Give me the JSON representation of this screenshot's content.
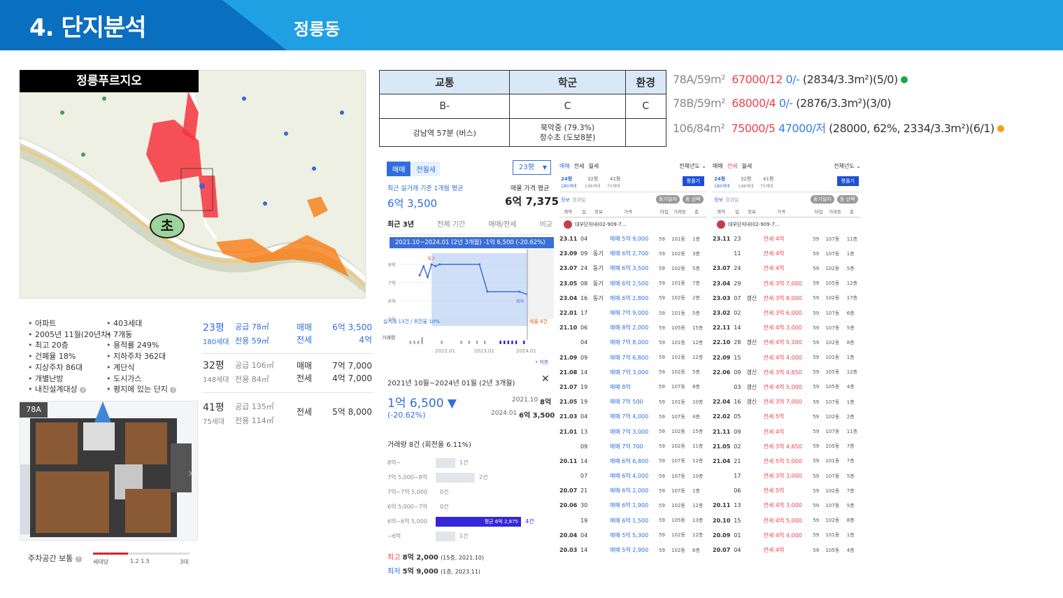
{
  "header": {
    "title": "4. 단지분석",
    "subtitle": "정릉동"
  },
  "map": {
    "label": "정릉푸르지오",
    "school_marker": "초"
  },
  "facts": {
    "left": [
      "아파트",
      "2005년 11월(20년차)",
      "최고 20층",
      "건폐율 18%",
      "지상주차 86대",
      "개별난방",
      "내진설계대상"
    ],
    "right": [
      "403세대",
      "7개동",
      "용적률 249%",
      "지하주차 362대",
      "계단식",
      "도시가스",
      "평지에 있는 단지"
    ]
  },
  "floorplan": {
    "tag": "78A"
  },
  "parking": {
    "label": "주차공간 보통",
    "per": "세대당",
    "ticks": "1.2 1.5",
    "max": "3대"
  },
  "types": [
    {
      "pyeong": "23평",
      "units": "180세대",
      "supply": "공급 78㎡",
      "exclusive": "전용 59㎡",
      "deal1": "매매",
      "price1": "6억 3,500",
      "deal2": "전세",
      "price2": "4억"
    },
    {
      "pyeong": "32평",
      "units": "148세대",
      "supply": "공급 106㎡",
      "exclusive": "전용 84㎡",
      "deal1": "매매",
      "price1": "7억 7,000",
      "deal2": "전세",
      "price2": "4억 7,000"
    },
    {
      "pyeong": "41평",
      "units": "75세대",
      "supply": "공급 135㎡",
      "exclusive": "전용 114㎡",
      "deal1": "전세",
      "price1": "5억 8,000",
      "deal2": "",
      "price2": ""
    }
  ],
  "grade": {
    "headers": [
      "교통",
      "학군",
      "환경"
    ],
    "grades": [
      "B-",
      "C",
      "C"
    ],
    "details": [
      "강남역 57분 (버스)",
      "북악중 (79.3%)",
      "정수초 (도보8분)",
      ""
    ]
  },
  "listings": [
    {
      "type": "78A/59m²",
      "sale": "67000/12",
      "rent": "0/-",
      "info": "(2834/3.3m²)(5/0)",
      "dot": "#1aa84a"
    },
    {
      "type": "78B/59m²",
      "sale": "68000/4",
      "rent": "0/-",
      "info": "(2876/3.3m²)(3/0)",
      "dot": ""
    },
    {
      "type": "106/84m²",
      "sale": "75000/5",
      "rent": "47000/저",
      "info": "(28000, 62%, 2334/3.3m²)(6/1)",
      "dot": "#f3a01f"
    }
  ],
  "price_panel": {
    "tab_sale": "매매",
    "tab_rent": "전월세",
    "size": "23평",
    "recent_label": "최근 실거래 기준 1개월 평균",
    "recent_value": "6억 3,500",
    "ask_label": "매물 가격 평균",
    "ask_value": "6억 7,375",
    "tabs": [
      "최근 3년",
      "전체 기간",
      "매매/전세",
      "비교"
    ],
    "banner": "2021.10~2024.01 (2년 3개월)  -1억 6,500 (-20.62%)",
    "y_ticks": [
      "8억",
      "7억",
      "6억",
      "5억"
    ],
    "x_ticks": [
      "2022.01",
      "2023.01",
      "2024.01"
    ],
    "max_label": "최고",
    "min_label": "최저",
    "volume_label": "거래량",
    "volume_note": "실거래 13건 / 회전율 10%",
    "listing_note": "매물 8건",
    "lowest_note": "• 저층",
    "range_label": "2021년 10월~2024년 01월 (2년 3개월)",
    "change": "1억 6,500 ▼",
    "change_pct": "(-20.62%)",
    "from_date": "2021.10",
    "from_price": "8억",
    "to_date": "2024.01",
    "to_price": "6억 3,500",
    "count_label": "거래량 8건 (회전율 6.11%)",
    "histogram": [
      {
        "range": "8억~",
        "count": "1건",
        "frac": 0.23
      },
      {
        "range": "7억 5,000~8억",
        "count": "2건",
        "frac": 0.46
      },
      {
        "range": "7억~7억 5,000",
        "count": "0건",
        "frac": 0
      },
      {
        "range": "6억 5,000~7억",
        "count": "0건",
        "frac": 0
      },
      {
        "range": "6억~6억 5,000",
        "count": "4건",
        "frac": 1,
        "avg": "평균 6억 2,875"
      },
      {
        "range": "~6억",
        "count": "1건",
        "frac": 0.23
      }
    ],
    "high_label": "최고",
    "high_value": "8억 2,000",
    "high_note": "(15층, 2021.10)",
    "low_label": "최저",
    "low_value": "5억 9,000",
    "low_note": "(1층, 2023.11)"
  },
  "chart_data": [
    {
      "type": "line",
      "title": "2021.10~2024.01 (2년 3개월)",
      "ylabel": "",
      "xlabel": "",
      "y_ticks": [
        "8억",
        "7억",
        "6억",
        "5억"
      ],
      "x_ticks": [
        "2022.01",
        "2023.01",
        "2024.01"
      ],
      "x": [
        "2021.10",
        "2021.11",
        "2021.12",
        "2022.01",
        "2022.02",
        "2022.03",
        "2023.01",
        "2023.03",
        "2023.11",
        "2024.01"
      ],
      "values": [
        7.4,
        7.9,
        7.3,
        8.0,
        7.9,
        8.0,
        8.0,
        6.5,
        6.5,
        6.35
      ]
    },
    {
      "type": "bar",
      "categories": [
        "8억~",
        "7억 5,000~8억",
        "7억~7억 5,000",
        "6억 5,000~7억",
        "6억~6억 5,000",
        "~6억"
      ],
      "values": [
        1,
        2,
        0,
        0,
        4,
        1
      ]
    }
  ],
  "deals_left": {
    "tabs": [
      "매매",
      "전세",
      "월세"
    ],
    "period": "전체년도",
    "sizes": [
      "24평",
      "32평",
      "41평"
    ],
    "units": [
      "180세대",
      "148세대",
      "75세대"
    ],
    "btn": "평풀기",
    "info": "정보",
    "compare": "경과일",
    "chip1": "동기일자",
    "chip2": "동 선택",
    "cols": [
      "계약",
      "일",
      "정보",
      "가격",
      "타입",
      "거래동",
      "층"
    ],
    "agent": "대우단지내(02-909-7…",
    "rows": [
      [
        "23.11",
        "04",
        "",
        "매매 5억 9,000",
        "59",
        "101동",
        "1층"
      ],
      [
        "23.09",
        "09",
        "동기",
        "매매 6억 2,700",
        "59",
        "102동",
        "3층"
      ],
      [
        "23.07",
        "24",
        "동기",
        "매매 6억 3,500",
        "59",
        "102동",
        "5층"
      ],
      [
        "23.05",
        "08",
        "동기",
        "매매 6억 2,500",
        "59",
        "101동",
        "7층"
      ],
      [
        "23.04",
        "16",
        "동기",
        "매매 6억 2,800",
        "59",
        "102동",
        "2층"
      ],
      [
        "22.01",
        "17",
        "",
        "매매 7억 9,000",
        "59",
        "101동",
        "5층"
      ],
      [
        "21.10",
        "06",
        "",
        "매매 8억 2,000",
        "59",
        "105동",
        "15층"
      ],
      [
        "",
        "04",
        "",
        "매매 7억 8,000",
        "59",
        "101동",
        "12층"
      ],
      [
        "21.09",
        "09",
        "",
        "매매 7억 6,800",
        "59",
        "101동",
        "12층"
      ],
      [
        "21.08",
        "14",
        "",
        "매매 7억 3,000",
        "59",
        "102동",
        "5층"
      ],
      [
        "21.07",
        "19",
        "",
        "매매 8억",
        "59",
        "107동",
        "8층"
      ],
      [
        "21.05",
        "19",
        "",
        "매매 7억 500",
        "59",
        "101동",
        "10층"
      ],
      [
        "21.03",
        "04",
        "",
        "매매 7억 4,000",
        "59",
        "107동",
        "4층"
      ],
      [
        "21.01",
        "13",
        "",
        "매매 7억 3,000",
        "59",
        "102동",
        "15층"
      ],
      [
        "",
        "09",
        "",
        "매매 7억 700",
        "59",
        "102동",
        "11층"
      ],
      [
        "20.11",
        "14",
        "",
        "매매 6억 6,800",
        "59",
        "107동",
        "12층"
      ],
      [
        "",
        "07",
        "",
        "매매 6억 4,000",
        "59",
        "107동",
        "10층"
      ],
      [
        "20.07",
        "21",
        "",
        "매매 6억 2,000",
        "59",
        "107동",
        "1층"
      ],
      [
        "20.06",
        "30",
        "",
        "매매 6억 1,900",
        "59",
        "102동",
        "12층"
      ],
      [
        "",
        "19",
        "",
        "매매 6억 1,500",
        "59",
        "105동",
        "13층"
      ],
      [
        "20.04",
        "04",
        "",
        "매매 5억 5,300",
        "59",
        "102동",
        "12층"
      ],
      [
        "20.03",
        "14",
        "",
        "매매 5억 2,900",
        "59",
        "102동",
        "6층"
      ]
    ]
  },
  "deals_right": {
    "tabs": [
      "매매",
      "전세",
      "월세"
    ],
    "period": "전체년도",
    "sizes": [
      "24평",
      "32평",
      "41평"
    ],
    "units": [
      "180세대",
      "148세대",
      "75세대"
    ],
    "btn": "평풀기",
    "info": "정보",
    "compare": "경과일",
    "chip1": "동기일자",
    "chip2": "동 선택",
    "cols": [
      "계약",
      "일",
      "정보",
      "가격",
      "타입",
      "거래동",
      "층"
    ],
    "agent": "대우단지내(02-909-7…",
    "rows": [
      [
        "23.11",
        "23",
        "",
        "전세 4억",
        "59",
        "107동",
        "11층"
      ],
      [
        "",
        "11",
        "",
        "전세 4억",
        "59",
        "107동",
        "1층"
      ],
      [
        "23.07",
        "24",
        "",
        "전세 4억",
        "59",
        "102동",
        "5층"
      ],
      [
        "23.04",
        "29",
        "",
        "전세 3억 7,000",
        "59",
        "105동",
        "12층"
      ],
      [
        "23.03",
        "07",
        "갱신",
        "전세 3억 8,000",
        "59",
        "102동",
        "17층"
      ],
      [
        "23.02",
        "02",
        "",
        "전세 3억 6,000",
        "59",
        "107동",
        "6층"
      ],
      [
        "22.11",
        "14",
        "",
        "전세 4억 3,000",
        "59",
        "107동",
        "5층"
      ],
      [
        "22.10",
        "28",
        "갱신",
        "전세 4억 5,100",
        "59",
        "102동",
        "8층"
      ],
      [
        "22.09",
        "15",
        "",
        "전세 4억 4,000",
        "59",
        "101동",
        "1층"
      ],
      [
        "22.06",
        "09",
        "갱신",
        "전세 3억 4,650",
        "59",
        "105동",
        "12층"
      ],
      [
        "",
        "03",
        "갱신",
        "전세 4억 5,000",
        "59",
        "105동",
        "4층"
      ],
      [
        "22.04",
        "16",
        "갱신",
        "전세 3억 7,000",
        "59",
        "107동",
        "1층"
      ],
      [
        "22.02",
        "05",
        "",
        "전세 5억",
        "59",
        "102동",
        "2층"
      ],
      [
        "21.11",
        "09",
        "",
        "전세 4억",
        "59",
        "107동",
        "11층"
      ],
      [
        "21.05",
        "02",
        "",
        "전세 3억 4,650",
        "59",
        "105동",
        "7층"
      ],
      [
        "21.04",
        "21",
        "",
        "전세 5억 5,000",
        "59",
        "101동",
        "7층"
      ],
      [
        "",
        "17",
        "",
        "전세 3억 3,000",
        "59",
        "107동",
        "5층"
      ],
      [
        "",
        "06",
        "",
        "전세 5억",
        "59",
        "102동",
        "7층"
      ],
      [
        "20.11",
        "13",
        "",
        "전세 4억 3,000",
        "59",
        "107동",
        "5층"
      ],
      [
        "20.10",
        "15",
        "",
        "전세 4억 5,000",
        "59",
        "102동",
        "8층"
      ],
      [
        "20.09",
        "01",
        "",
        "전세 4억 4,000",
        "59",
        "101동",
        "1층"
      ],
      [
        "20.07",
        "04",
        "",
        "전세 4억",
        "59",
        "105동",
        "4층"
      ]
    ]
  },
  "colors": {
    "header": "#1fa0e3",
    "header_dark": "#0b6fbf",
    "accent": "#2f6fdc",
    "red": "#f0414f"
  }
}
